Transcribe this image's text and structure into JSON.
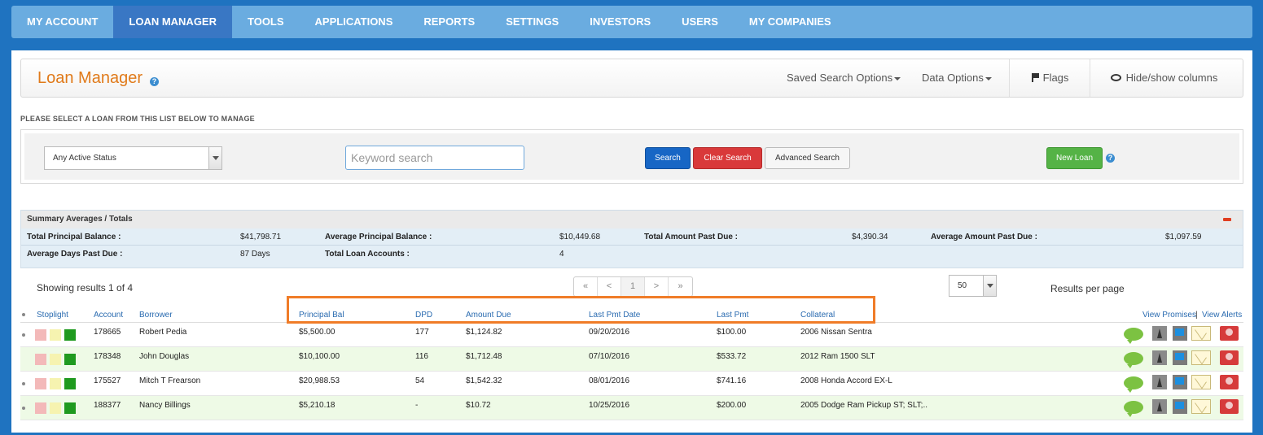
{
  "nav": {
    "items": [
      "MY ACCOUNT",
      "LOAN MANAGER",
      "TOOLS",
      "APPLICATIONS",
      "REPORTS",
      "SETTINGS",
      "INVESTORS",
      "USERS",
      "MY COMPANIES"
    ],
    "active": "LOAN MANAGER"
  },
  "header": {
    "title": "Loan Manager",
    "saved_search": "Saved Search Options",
    "data_options": "Data Options",
    "flags": "Flags",
    "hide_show": "Hide/show columns"
  },
  "search": {
    "instruction": "PLEASE SELECT A LOAN FROM THIS LIST BELOW TO MANAGE",
    "status_value": "Any Active Status",
    "keyword_placeholder": "Keyword search",
    "search_label": "Search",
    "clear_label": "Clear Search",
    "advanced_label": "Advanced Search",
    "new_loan_label": "New Loan"
  },
  "summary": {
    "title": "Summary Averages / Totals",
    "total_principal_label": "Total Principal Balance :",
    "total_principal_value": "$41,798.71",
    "avg_principal_label": "Average Principal Balance :",
    "avg_principal_value": "$10,449.68",
    "total_past_due_label": "Total Amount Past Due :",
    "total_past_due_value": "$4,390.34",
    "avg_past_due_label": "Average Amount Past Due :",
    "avg_past_due_value": "$1,097.59",
    "avg_dpd_label": "Average Days Past Due :",
    "avg_dpd_value": "87 Days",
    "total_accounts_label": "Total Loan Accounts :",
    "total_accounts_value": "4"
  },
  "results": {
    "showing": "Showing results 1 of 4",
    "pager": [
      "«",
      "<",
      "1",
      ">",
      "»"
    ],
    "per_page_value": "50",
    "per_page_label": "Results per page"
  },
  "table": {
    "headers": {
      "stoplight": "Stoplight",
      "account": "Account",
      "borrower": "Borrower",
      "principal": "Principal Bal",
      "dpd": "DPD",
      "amount_due": "Amount Due",
      "last_pmt_date": "Last Pmt Date",
      "last_pmt": "Last Pmt",
      "collateral": "Collateral",
      "view_promises": "View Promises",
      "view_alerts": "View Alerts"
    },
    "rows": [
      {
        "account": "178665",
        "borrower": "Robert Pedia",
        "principal": "$5,500.00",
        "dpd": "177",
        "amount_due": "$1,124.82",
        "last_pmt_date": "09/20/2016",
        "last_pmt": "$100.00",
        "collateral": "2006 Nissan Sentra"
      },
      {
        "account": "178348",
        "borrower": "John Douglas",
        "principal": "$10,100.00",
        "dpd": "116",
        "amount_due": "$1,712.48",
        "last_pmt_date": "07/10/2016",
        "last_pmt": "$533.72",
        "collateral": "2012 Ram 1500 SLT"
      },
      {
        "account": "175527",
        "borrower": "Mitch T Frearson",
        "principal": "$20,988.53",
        "dpd": "54",
        "amount_due": "$1,542.32",
        "last_pmt_date": "08/01/2016",
        "last_pmt": "$741.16",
        "collateral": "2008 Honda Accord EX-L"
      },
      {
        "account": "188377",
        "borrower": "Nancy Billings",
        "principal": "$5,210.18",
        "dpd": "-",
        "amount_due": "$10.72",
        "last_pmt_date": "10/25/2016",
        "last_pmt": "$200.00",
        "collateral": "2005 Dodge Ram Pickup ST; SLT;.."
      }
    ]
  },
  "colors": {
    "nav_bg": "#6aace0",
    "nav_active": "#3977c4",
    "page_bg": "#1f73c0",
    "title_orange": "#e07a1a",
    "highlight": "#f07c28"
  }
}
